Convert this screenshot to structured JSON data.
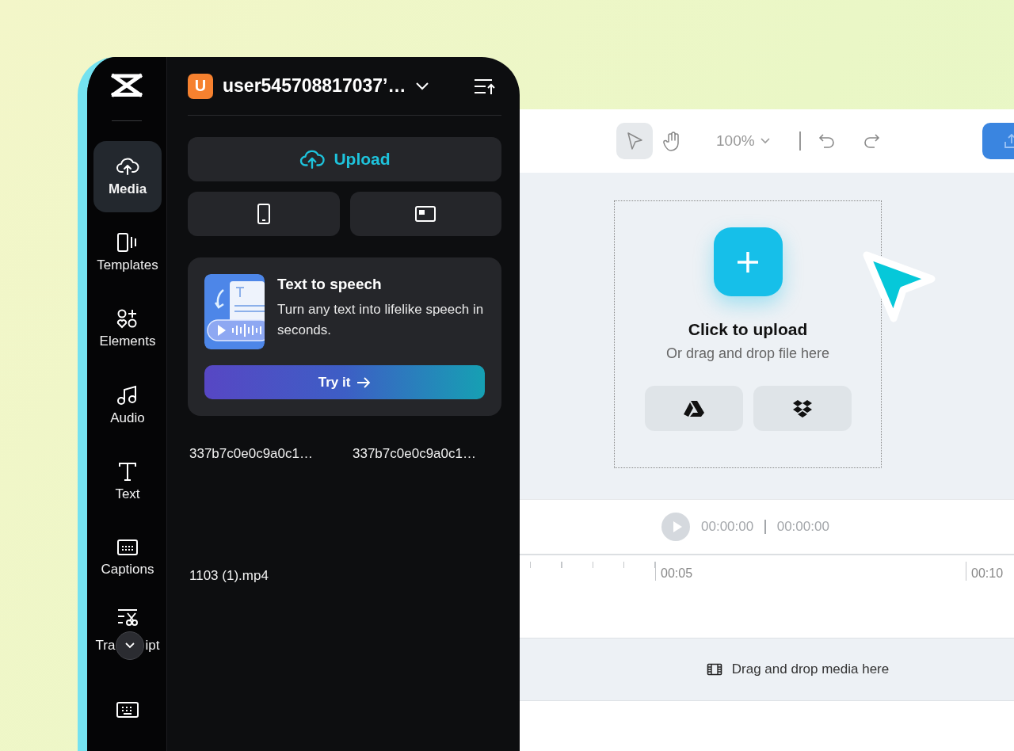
{
  "sidebar": {
    "items": [
      {
        "kind": "media",
        "label": "Media",
        "selected": true
      },
      {
        "kind": "templates",
        "label": "Templates",
        "selected": false
      },
      {
        "kind": "elements",
        "label": "Elements",
        "selected": false
      },
      {
        "kind": "audio",
        "label": "Audio",
        "selected": false
      },
      {
        "kind": "text",
        "label": "Text",
        "selected": false
      },
      {
        "kind": "captions",
        "label": "Captions",
        "selected": false
      },
      {
        "kind": "transcript",
        "label_parts": [
          "Tra",
          "ipt"
        ],
        "selected": false
      },
      {
        "kind": "keyboard",
        "selected": false
      }
    ]
  },
  "account": {
    "avatar": "U",
    "name": "user545708817037’…"
  },
  "upload_button": "Upload",
  "promo": {
    "title": "Text to speech",
    "description": "Turn any text into lifelike speech in seconds.",
    "button": "Try it"
  },
  "files": [
    "337b7c0e0c9a0c1…",
    "337b7c0e0c9a0c1…",
    "1103 (1).mp4"
  ],
  "toolbar": {
    "zoom": "100%",
    "tools": [
      {
        "kind": "select",
        "selected": true
      },
      {
        "kind": "hand",
        "selected": false
      }
    ]
  },
  "dropzone": {
    "title": "Click to upload",
    "subtitle": "Or drag and drop file here"
  },
  "player": {
    "current": "00:00:00",
    "total": "00:00:00"
  },
  "ruler": [
    "00:05",
    "00:10"
  ],
  "track": {
    "hint": "Drag and drop media here"
  }
}
